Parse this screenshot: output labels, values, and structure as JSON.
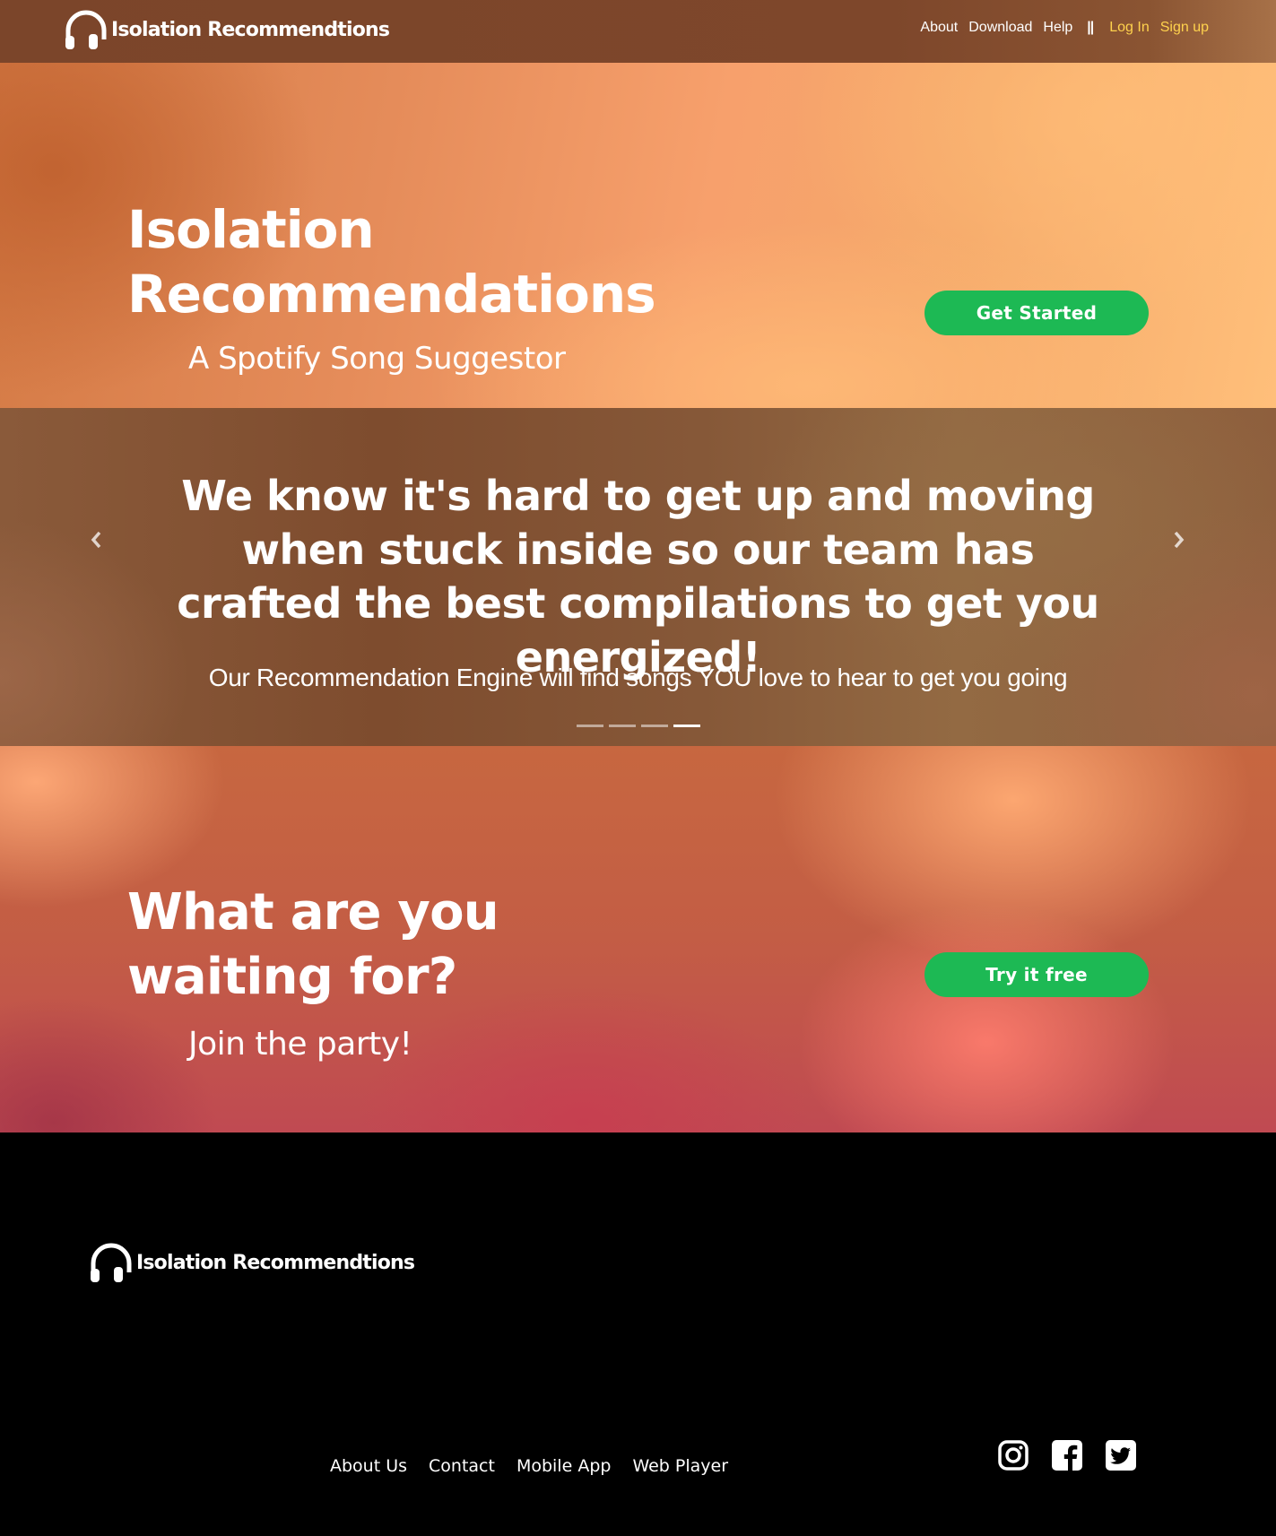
{
  "navbar": {
    "brand": "Isolation Recommendtions",
    "links": [
      "About",
      "Download",
      "Help"
    ],
    "separator": "||",
    "login": "Log In",
    "signup": "Sign up"
  },
  "hero": {
    "title_line1": "Isolation",
    "title_line2": "Recommendations",
    "subtitle": "A Spotify Song Suggestor",
    "button": "Get Started"
  },
  "carousel": {
    "heading": "We know it's hard to get up and moving when stuck inside so our team has crafted the best compilations to get you energized!",
    "subtext": "Our Recommendation Engine will find songs YOU love to hear to get you going",
    "slide_count": 4,
    "active_slide": 4
  },
  "cta": {
    "title": "What are you waiting for?",
    "subtitle": "Join the party!",
    "button": "Try it free"
  },
  "footer": {
    "brand": "Isolation Recommendtions",
    "links": [
      "About Us",
      "Contact",
      "Mobile App",
      "Web Player"
    ],
    "socials": [
      "instagram-icon",
      "facebook-icon",
      "twitter-icon"
    ]
  },
  "colors": {
    "accent_green": "#1db954",
    "nav_accent": "#ffd24d",
    "nav_bg": "#7b452a"
  }
}
